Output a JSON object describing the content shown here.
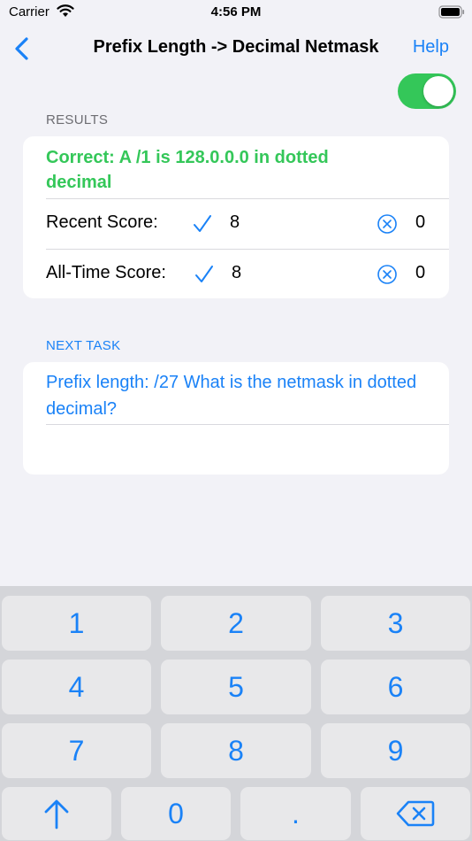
{
  "status_bar": {
    "carrier": "Carrier",
    "time": "4:56 PM"
  },
  "nav": {
    "title": "Prefix Length -> Decimal Netmask",
    "help_label": "Help"
  },
  "toggle": {
    "on": true,
    "color": "#34c759"
  },
  "results": {
    "header": "RESULTS",
    "message": "Correct: A /1 is 128.0.0.0 in dotted decimal",
    "recent_label": "Recent Score:",
    "recent_correct": "8",
    "recent_wrong": "0",
    "alltime_label": "All-Time Score:",
    "alltime_correct": "8",
    "alltime_wrong": "0"
  },
  "next_task": {
    "header": "NEXT TASK",
    "question": "Prefix length: /27 What is the netmask in dotted decimal?",
    "answer": ""
  },
  "keypad": {
    "k1": "1",
    "k2": "2",
    "k3": "3",
    "k4": "4",
    "k5": "5",
    "k6": "6",
    "k7": "7",
    "k8": "8",
    "k9": "9",
    "k0": "0",
    "kdot": "."
  },
  "colors": {
    "accent": "#1a82f7",
    "success": "#34c759",
    "background": "#f2f2f7"
  }
}
